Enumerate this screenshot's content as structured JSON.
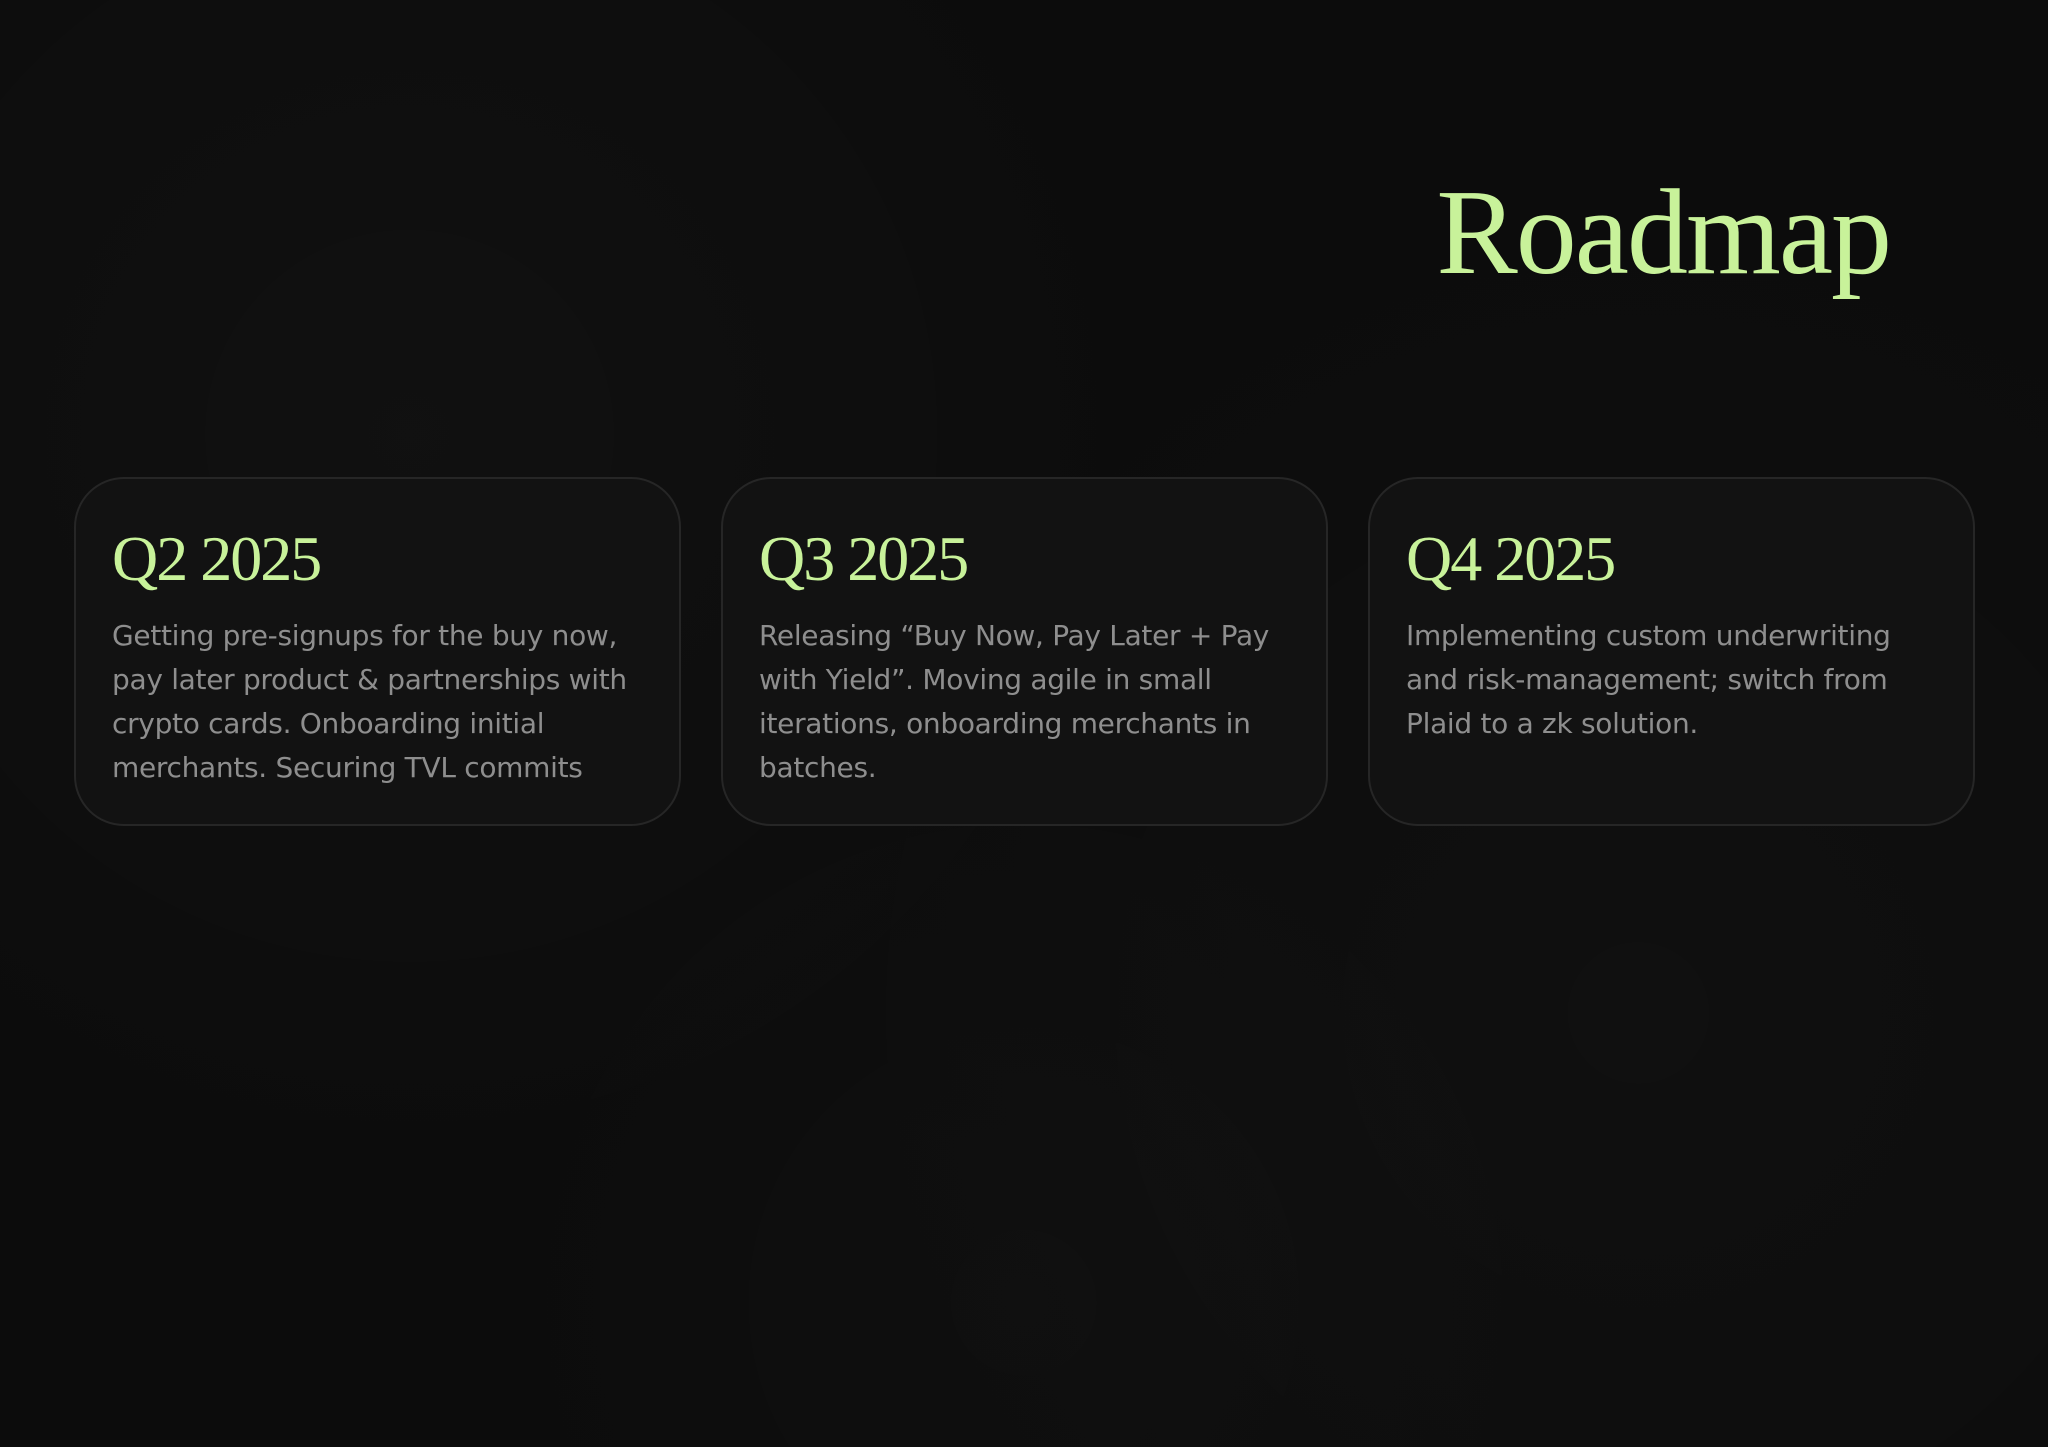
{
  "page": {
    "title": "Roadmap",
    "accent_color": "#c8f29a",
    "background_color": "#0c0c0c",
    "card_color": "#121212"
  },
  "cards": [
    {
      "title": "Q2 2025",
      "text": "Getting pre-signups for the buy now, pay later product & partnerships with crypto cards. Onboarding initial merchants. Securing TVL commits"
    },
    {
      "title": "Q3 2025",
      "text": "Releasing “Buy Now, Pay Later + Pay with Yield”. Moving agile in small iterations, onboarding merchants in batches."
    },
    {
      "title": "Q4 2025",
      "text": "Implementing custom underwriting and risk-management; switch from Plaid to a zk solution."
    }
  ]
}
